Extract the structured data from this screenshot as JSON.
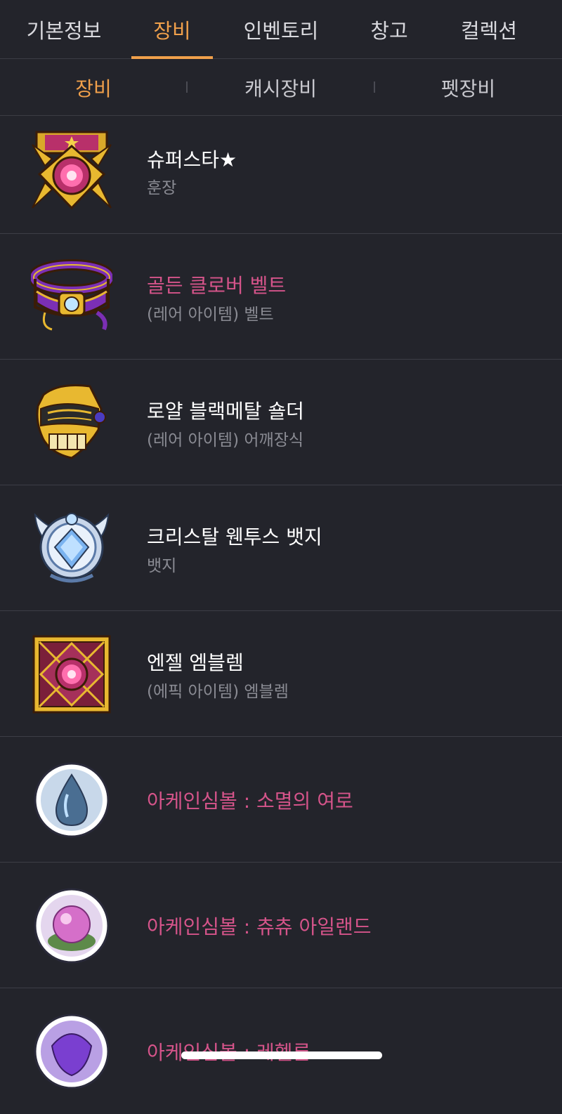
{
  "tabs": [
    {
      "label": "기본정보"
    },
    {
      "label": "장비"
    },
    {
      "label": "인벤토리"
    },
    {
      "label": "창고"
    },
    {
      "label": "컬렉션"
    }
  ],
  "active_tab": "장비",
  "subtabs": [
    {
      "label": "장비"
    },
    {
      "label": "캐시장비"
    },
    {
      "label": "펫장비"
    }
  ],
  "active_subtab": "장비",
  "colors": {
    "accent": "#f0a04b",
    "background": "#23242b",
    "rare_name": "#d5548a",
    "normal_name": "#ffffff",
    "subtitle": "#8a8b93"
  },
  "items": [
    {
      "name": "슈퍼스타★",
      "subtitle": "훈장",
      "icon": "medal-icon",
      "name_color": "white"
    },
    {
      "name": "골든 클로버 벨트",
      "subtitle": "(레어 아이템) 벨트",
      "icon": "belt-icon",
      "name_color": "pink"
    },
    {
      "name": "로얄 블랙메탈 숄더",
      "subtitle": "(레어 아이템) 어깨장식",
      "icon": "shoulder-icon",
      "name_color": "white"
    },
    {
      "name": "크리스탈 웬투스 뱃지",
      "subtitle": "뱃지",
      "icon": "badge-icon",
      "name_color": "white"
    },
    {
      "name": "엔젤 엠블렘",
      "subtitle": "(에픽 아이템) 엠블렘",
      "icon": "emblem-icon",
      "name_color": "white"
    },
    {
      "name": "아케인심볼 : 소멸의 여로",
      "subtitle": "",
      "icon": "arcane-symbol-icon",
      "name_color": "pink"
    },
    {
      "name": "아케인심볼 : 츄츄 아일랜드",
      "subtitle": "",
      "icon": "arcane-symbol-icon",
      "name_color": "pink"
    },
    {
      "name": "아케인심볼 : 레헬른",
      "subtitle": "",
      "icon": "arcane-symbol-icon",
      "name_color": "pink"
    }
  ]
}
